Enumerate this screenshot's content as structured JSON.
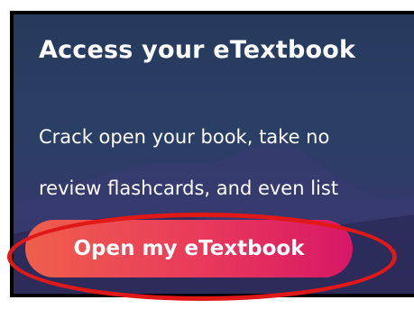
{
  "card": {
    "title": "Access your eTextbook",
    "body_line_1": "Crack open your book, take no",
    "body_line_2": "review flashcards, and even list"
  },
  "button": {
    "label": "Open my eTextbook"
  },
  "colors": {
    "card_background": "#2a3f66",
    "button_gradient_start": "#ef5f4c",
    "button_gradient_end": "#d81766",
    "highlight_ring": "#e11818",
    "text": "#ffffff"
  }
}
